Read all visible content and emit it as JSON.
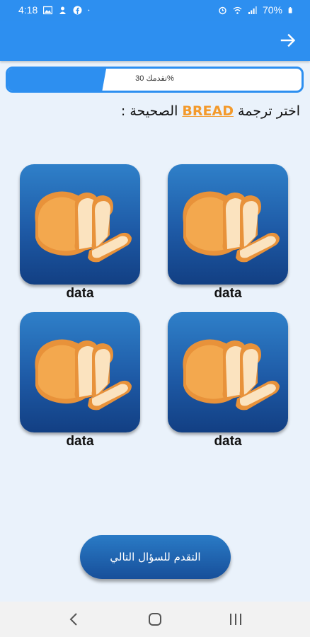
{
  "status_bar": {
    "time": "4:18",
    "battery": "70%"
  },
  "progress": {
    "label": "نقدمك 30%",
    "fraction": 0.335
  },
  "question": {
    "prefix": "اختر ترجمة",
    "word": "BREAD",
    "suffix": "الصحيحة :"
  },
  "options": [
    {
      "label": "data",
      "image": "bread-icon"
    },
    {
      "label": "data",
      "image": "bread-icon"
    },
    {
      "label": "data",
      "image": "bread-icon"
    },
    {
      "label": "data",
      "image": "bread-icon"
    }
  ],
  "next_button": {
    "label": "التقدم للسؤال التالي"
  },
  "colors": {
    "primary": "#2d8ff0",
    "tile_dark": "#123f83",
    "highlight": "#f39a2c",
    "background": "#eaf2fb"
  }
}
